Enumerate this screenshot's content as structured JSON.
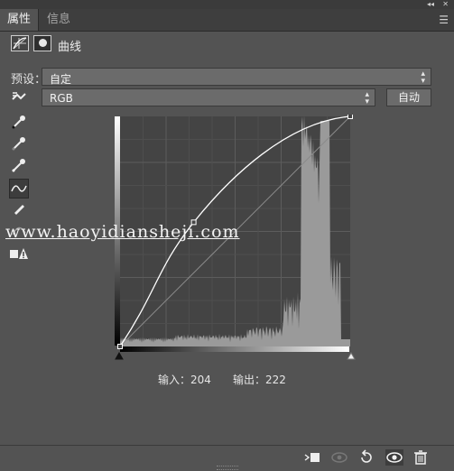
{
  "tabs": [
    {
      "label": "属性",
      "active": true
    },
    {
      "label": "信息",
      "active": false
    }
  ],
  "panel": {
    "title": "曲线"
  },
  "preset": {
    "label": "预设：",
    "value": "自定"
  },
  "channel": {
    "value": "RGB"
  },
  "auto_button": "自动",
  "watermark": "www.haoyidiansheji.com",
  "readout": {
    "input": "输入：204",
    "output": "输出：222"
  },
  "curve": {
    "input": 204,
    "output": 222,
    "range": [
      0,
      255
    ]
  },
  "histogram": {
    "channel": "RGB",
    "range": [
      0,
      255
    ],
    "peak_region": [
      200,
      230
    ]
  },
  "tools": [
    {
      "icon": "on-image-adjust-icon"
    },
    {
      "icon": "black-point-eyedropper-icon"
    },
    {
      "icon": "gray-point-eyedropper-icon"
    },
    {
      "icon": "white-point-eyedropper-icon"
    },
    {
      "icon": "curve-point-edit-icon"
    },
    {
      "icon": "pencil-draw-icon"
    },
    {
      "icon": "smooth-curve-icon"
    },
    {
      "icon": "clipping-warning-icon"
    }
  ],
  "bottom_icons": [
    "clip-to-layer-icon",
    "view-previous-icon",
    "reset-icon",
    "visibility-eye-icon",
    "delete-trash-icon"
  ],
  "colors": {
    "panel_bg": "#535353",
    "graph_bg": "#444444",
    "curve": "#ffffff",
    "histogram": "#9a9a9a"
  }
}
